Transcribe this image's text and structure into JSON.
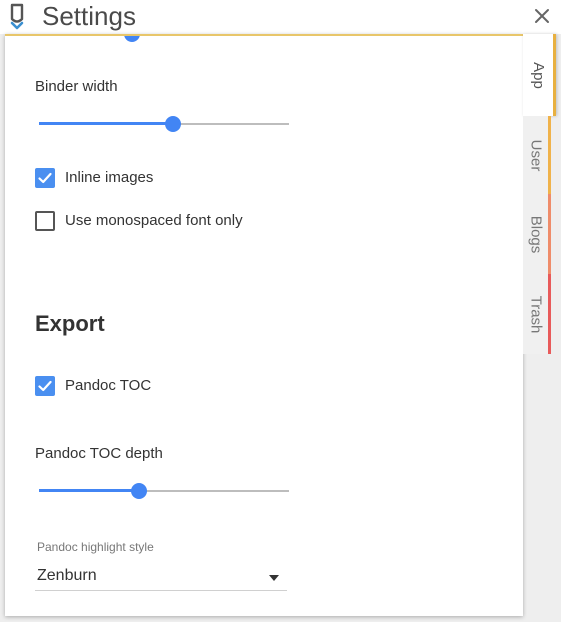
{
  "window": {
    "title": "Settings",
    "app_icon": "pen-nib-icon",
    "close_icon": "close-icon"
  },
  "tabs": [
    {
      "label": "App",
      "active": true,
      "accent": "#e8b040"
    },
    {
      "label": "User",
      "active": false,
      "accent": "#f0b24a"
    },
    {
      "label": "Blogs",
      "active": false,
      "accent": "#ef8c6a"
    },
    {
      "label": "Trash",
      "active": false,
      "accent": "#e85a5a"
    }
  ],
  "app": {
    "top_slider": {
      "value_fraction": 0.37
    },
    "binder_width": {
      "label": "Binder width",
      "value_fraction": 0.535
    },
    "inline_images": {
      "label": "Inline images",
      "checked": true
    },
    "monospaced_font": {
      "label": "Use monospaced font only",
      "checked": false
    },
    "export": {
      "title": "Export",
      "pandoc_toc": {
        "label": "Pandoc TOC",
        "checked": true
      },
      "pandoc_toc_depth": {
        "label": "Pandoc TOC depth",
        "value_fraction": 0.4
      },
      "pandoc_highlight_style": {
        "label": "Pandoc highlight style",
        "value": "Zenburn"
      }
    }
  },
  "colors": {
    "accent_blue": "#4285f4",
    "track_gray": "#bdbdbd"
  }
}
